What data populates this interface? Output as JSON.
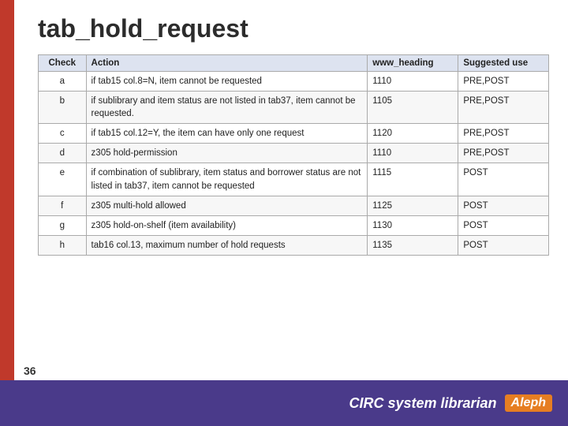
{
  "page": {
    "title": "tab_hold_request",
    "page_number": "36",
    "footer_text": "CIRC system librarian",
    "footer_logo": "Aleph"
  },
  "table": {
    "columns": [
      {
        "key": "check",
        "label": "Check"
      },
      {
        "key": "action",
        "label": "Action"
      },
      {
        "key": "www_heading",
        "label": "www_heading"
      },
      {
        "key": "suggested_use",
        "label": "Suggested use"
      }
    ],
    "rows": [
      {
        "check": "a",
        "action": "if tab15 col.8=N, item cannot be requested",
        "www_heading": "1110",
        "suggested_use": "PRE,POST"
      },
      {
        "check": "b",
        "action": "if sublibrary and item status are not listed in tab37, item cannot be requested.",
        "www_heading": "1105",
        "suggested_use": "PRE,POST"
      },
      {
        "check": "c",
        "action": "if tab15 col.12=Y, the item can have only one request",
        "www_heading": "1120",
        "suggested_use": "PRE,POST"
      },
      {
        "check": "d",
        "action": "z305 hold-permission",
        "www_heading": "1110",
        "suggested_use": "PRE,POST"
      },
      {
        "check": "e",
        "action": "if combination of sublibrary, item status and borrower status are not listed in tab37, item cannot be requested",
        "www_heading": "1115",
        "suggested_use": "POST"
      },
      {
        "check": "f",
        "action": "z305 multi-hold allowed",
        "www_heading": "1125",
        "suggested_use": "POST"
      },
      {
        "check": "g",
        "action": "z305 hold-on-shelf (item availability)",
        "www_heading": "1130",
        "suggested_use": "POST"
      },
      {
        "check": "h",
        "action": "tab16 col.13, maximum number of hold requests",
        "www_heading": "1135",
        "suggested_use": "POST"
      }
    ]
  }
}
